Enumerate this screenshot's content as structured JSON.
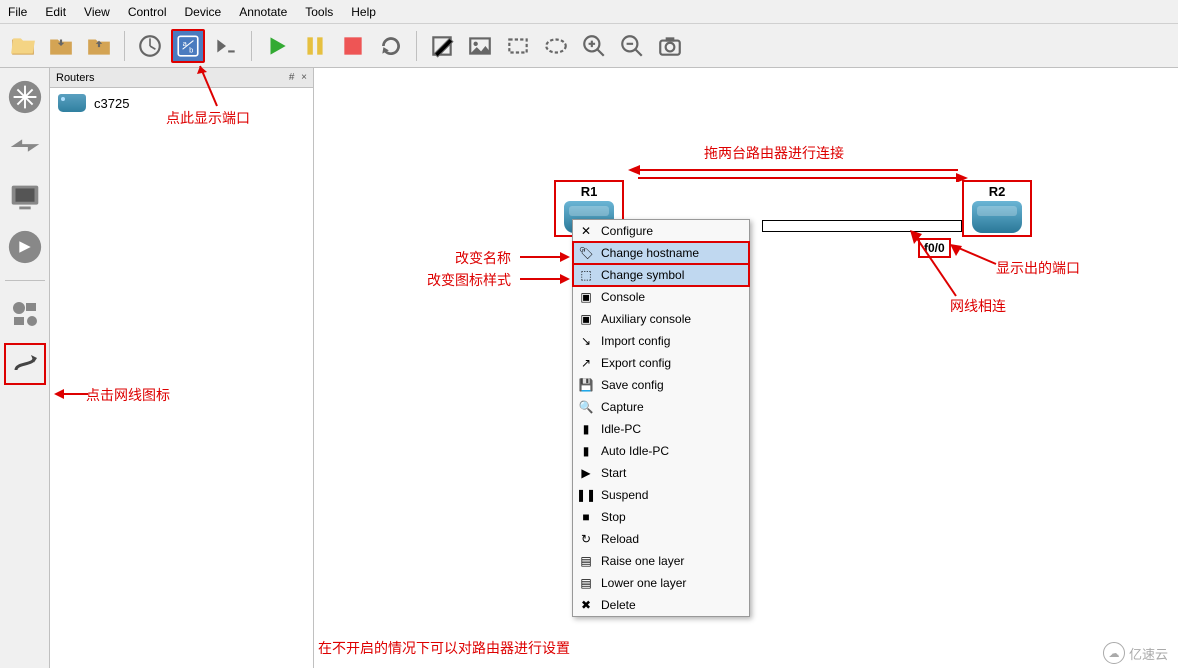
{
  "menu": {
    "file": "File",
    "edit": "Edit",
    "view": "View",
    "control": "Control",
    "device": "Device",
    "annotate": "Annotate",
    "tools": "Tools",
    "help": "Help"
  },
  "panel": {
    "title": "Routers",
    "controls": "# ×",
    "items": [
      {
        "name": "c3725"
      }
    ]
  },
  "nodes": {
    "r1": "R1",
    "r2": "R2"
  },
  "port": "f0/0",
  "context_menu": [
    {
      "label": "Configure",
      "icon": "✕"
    },
    {
      "label": "Change hostname",
      "icon": "🏷"
    },
    {
      "label": "Change symbol",
      "icon": "⬚"
    },
    {
      "label": "Console",
      "icon": "▣"
    },
    {
      "label": "Auxiliary console",
      "icon": "▣"
    },
    {
      "label": "Import config",
      "icon": "↘"
    },
    {
      "label": "Export config",
      "icon": "↗"
    },
    {
      "label": "Save config",
      "icon": "💾"
    },
    {
      "label": "Capture",
      "icon": "🔍"
    },
    {
      "label": "Idle-PC",
      "icon": "▮"
    },
    {
      "label": "Auto Idle-PC",
      "icon": "▮"
    },
    {
      "label": "Start",
      "icon": "▶"
    },
    {
      "label": "Suspend",
      "icon": "❚❚"
    },
    {
      "label": "Stop",
      "icon": "■"
    },
    {
      "label": "Reload",
      "icon": "↻"
    },
    {
      "label": "Raise one layer",
      "icon": "▤"
    },
    {
      "label": "Lower one layer",
      "icon": "▤"
    },
    {
      "label": "Delete",
      "icon": "✖"
    }
  ],
  "annotations": {
    "show_ports": "点此显示端口",
    "cable_icon": "点击网线图标",
    "change_name": "改变名称",
    "change_symbol": "改变图标样式",
    "drag_connect": "拖两台路由器进行连接",
    "port_shown": "显示出的端口",
    "wire_connect": "网线相连",
    "offline_config": "在不开启的情况下可以对路由器进行设置"
  },
  "watermark": "亿速云"
}
